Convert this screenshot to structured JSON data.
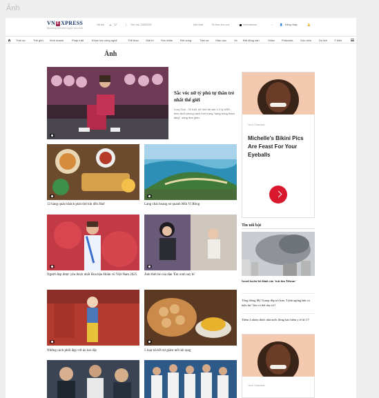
{
  "outer": {
    "title": "Ảnh"
  },
  "site": {
    "logo": {
      "left": "VN",
      "e": "E",
      "right": "XPRESS"
    },
    "tagline": "Báo tiếng Việt nhiều người xem nhất",
    "location": "Hà Nội",
    "temperature": "32°",
    "date": "Thứ hai, 23/6/2025",
    "topbar_links": [
      "Mới nhất",
      "Tin theo khu vực",
      "International"
    ],
    "login": "Đăng nhập"
  },
  "nav": {
    "items": [
      "Thời sự",
      "Thế giới",
      "Kinh doanh",
      "Pháp luật",
      "Khoa học công nghệ",
      "Thể thao",
      "Giải trí",
      "Sức khỏe",
      "Đời sống",
      "Tâm sự",
      "Giáo dục",
      "Xe",
      "Bất động sản",
      "Video",
      "Podcasts",
      "Góc nhìn",
      "Du lịch",
      "Ý kiến"
    ]
  },
  "main": {
    "section_title": "Ảnh",
    "feature": {
      "title": "Sắc vóc nữ tỷ phú tự thân trẻ nhất thế giới",
      "description": "Lucy Guo - 31 tuổi, sở hữu tài sản 1,3 tỷ USD - theo đuổi phong cách thời trang \"sang trọng thầm lặng\", sống đơn giản."
    },
    "grid": [
      {
        "caption": "12 hàng quán khách phải thử khi đến Huế"
      },
      {
        "caption": "Làng chài hoang sơ quanh Mũi Vi Rồng"
      },
      {
        "caption": "Người đẹp được yêu thích nhất Hoa hậu Hoàn vũ Việt Nam 2025"
      },
      {
        "caption": "Ảnh thời bé của dàn 'Em xinh say hi'"
      },
      {
        "caption": "Những cách phối đẹp với áo hai dây"
      },
      {
        "caption": "5 loại trà hỗ trợ giảm mỡ nội tạng"
      }
    ]
  },
  "sidebar": {
    "ad1": {
      "brand": "Your Charmia",
      "headline": "Michelle's Bikini Pics Are Feast For Your Eyeballs"
    },
    "hot_title": "Tin nổi bật",
    "hot_news": [
      "Israel tuyên bố đánh vào 'trái tim Tehran'",
      "Tổng thống Mỹ Trump đáp trả Iran: 'Lệnh ngừng bắn có hiệu lực' liệu có thể duy trì?",
      "Thêm 4 nhóm được nhà nước đóng bảo hiểm y tế từ 1/7"
    ],
    "ad2": {
      "brand": "Your Charmia"
    }
  },
  "colors": {
    "brand": "#9f224e",
    "ad_button": "#d9182d",
    "logo_text": "#1b3a6b"
  }
}
